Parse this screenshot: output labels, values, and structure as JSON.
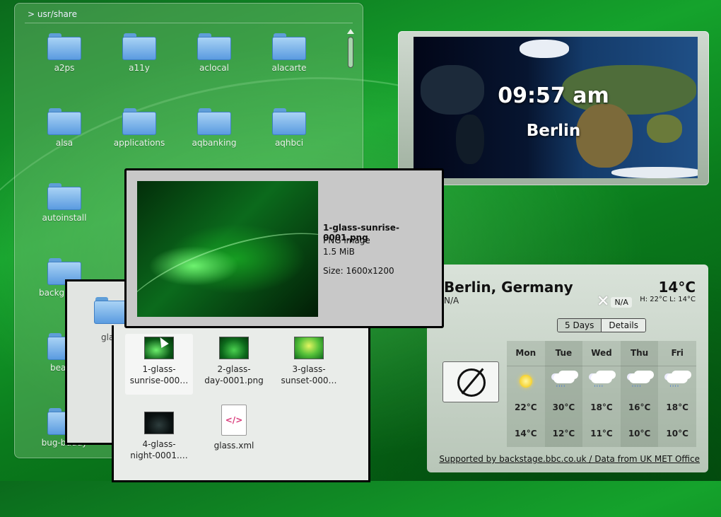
{
  "folderview": {
    "path": "> usr/share",
    "items": [
      {
        "label": "a2ps"
      },
      {
        "label": "a11y"
      },
      {
        "label": "aclocal"
      },
      {
        "label": "alacarte"
      },
      {
        "label": "alsa"
      },
      {
        "label": "applications"
      },
      {
        "label": "aqbanking"
      },
      {
        "label": "aqhbci"
      },
      {
        "label": "autoinstall"
      },
      {
        "label": "backg"
      },
      {
        "label": "bea"
      },
      {
        "label": "bug-buddy"
      }
    ]
  },
  "clock": {
    "time": "09:57 am",
    "city": "Berlin"
  },
  "tooltip": {
    "filename": "1-glass-sunrise-0001.png",
    "type": "PNG image",
    "size": "1.5 MiB",
    "dimensions": "Size: 1600x1200"
  },
  "popup": {
    "back_label": "gla",
    "files": [
      {
        "label": "1-glass-\nsunrise-000…",
        "thumb": "sunrise"
      },
      {
        "label": "2-glass-\nday-0001.png",
        "thumb": "day"
      },
      {
        "label": "3-glass-\nsunset-000…",
        "thumb": "sunset"
      },
      {
        "label": "4-glass-\nnight-0001.…",
        "thumb": "night"
      },
      {
        "label": "glass.xml",
        "thumb": "xml"
      }
    ],
    "xml_glyph": "</>"
  },
  "weather": {
    "city": "Berlin, Germany",
    "condition": "N/A",
    "temperature": "14°C",
    "high_low": "H: 22°C L: 14°C",
    "na_badge": "N/A",
    "na_x": "✕",
    "tabs": [
      "5 Days",
      "Details"
    ],
    "forecast": [
      {
        "day": "Mon",
        "icon": "sun-icon",
        "high": "22°C",
        "low": "14°C"
      },
      {
        "day": "Tue",
        "icon": "rain-cloud-icon",
        "high": "30°C",
        "low": "12°C"
      },
      {
        "day": "Wed",
        "icon": "rain-cloud-icon",
        "high": "18°C",
        "low": "11°C"
      },
      {
        "day": "Thu",
        "icon": "rain-cloud-icon",
        "high": "16°C",
        "low": "10°C"
      },
      {
        "day": "Fri",
        "icon": "rain-cloud-icon",
        "high": "18°C",
        "low": "10°C"
      }
    ],
    "footer": "Supported by backstage.bbc.co.uk / Data from UK MET Office"
  }
}
